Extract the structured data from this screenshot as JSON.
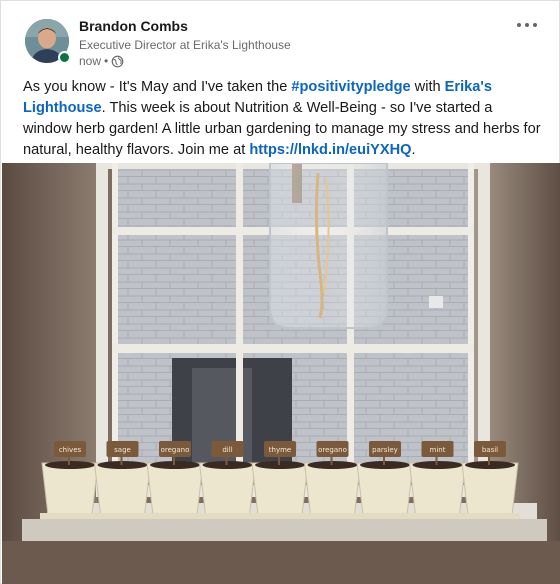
{
  "author": {
    "name": "Brandon Combs",
    "headline": "Executive Director at Erika's Lighthouse",
    "time": "now",
    "separator": "•",
    "visibility_icon": "globe-icon"
  },
  "post": {
    "text_1": "As you know - It's May and I've taken the ",
    "hashtag": "#positivitypledge",
    "text_2": " with ",
    "mention": "Erika's Lighthouse",
    "text_3": ". This week is about Nutrition & Well-Being - so I've started a window herb garden! A little urban gardening to manage my stress and herbs for natural, healthy flavors. Join me at ",
    "link": "https://lnkd.in/euiYXHQ",
    "text_4": "."
  },
  "photo": {
    "plant_labels": [
      "chives",
      "sage",
      "oregano",
      "dill",
      "thyme",
      "oregano",
      "parsley",
      "mint",
      "basil"
    ]
  },
  "colors": {
    "link": "#0a66c2",
    "presence": "#057642"
  }
}
